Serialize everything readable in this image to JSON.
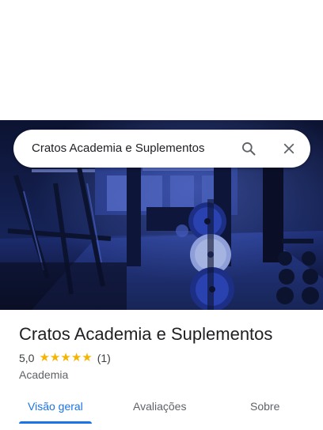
{
  "search": {
    "query": "Cratos Academia e Suplementos",
    "search_icon": "search-icon",
    "close_icon": "close-icon"
  },
  "hero_image": {
    "description_icon": "gym-interior-photo"
  },
  "place": {
    "name": "Cratos Academia e Suplementos",
    "rating": "5,0",
    "rating_value": 5.0,
    "stars": [
      "★",
      "★",
      "★",
      "★",
      "★"
    ],
    "review_count": "(1)",
    "category": "Academia"
  },
  "tabs": [
    {
      "label": "Visão geral",
      "active": true
    },
    {
      "label": "Avaliações",
      "active": false
    },
    {
      "label": "Sobre",
      "active": false
    }
  ],
  "colors": {
    "accent": "#1a73e8",
    "star": "#f5b400",
    "hero_tint": "#1d2f7a"
  }
}
